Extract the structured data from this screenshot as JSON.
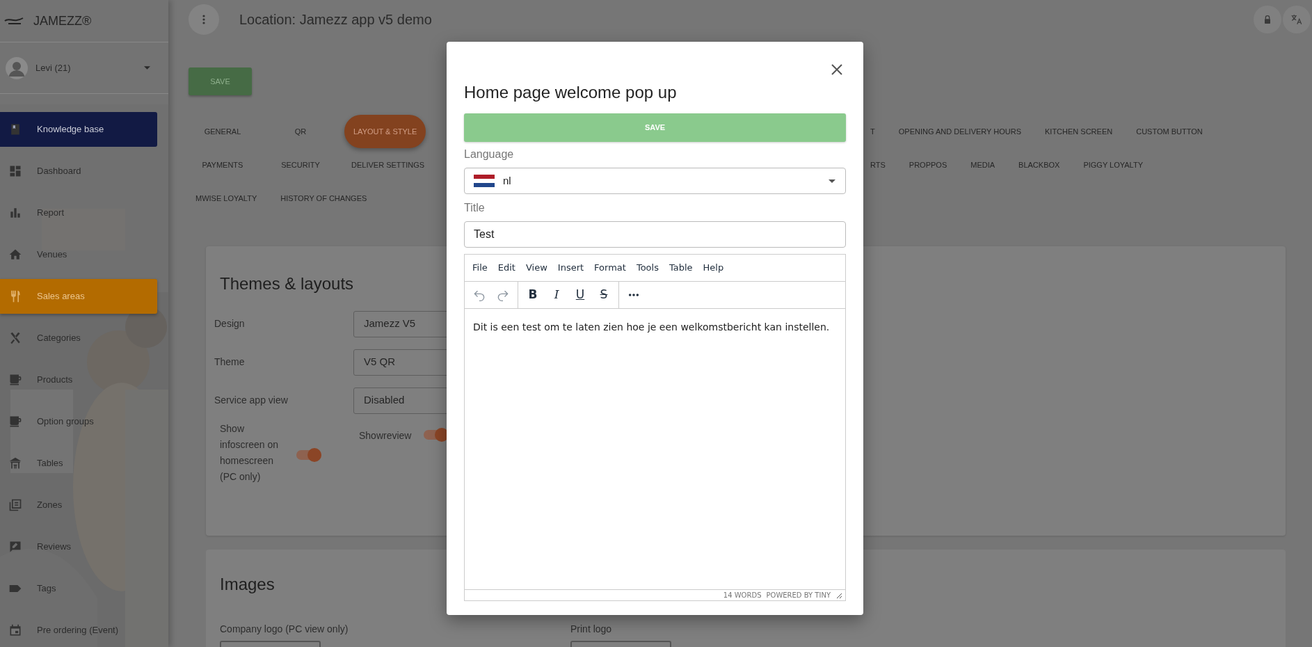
{
  "brand": {
    "name": "JAMEZZ®"
  },
  "user": {
    "name": "Levi (21)"
  },
  "sidebar": {
    "items": [
      {
        "label": "Knowledge base",
        "kind": "featured",
        "selected": false
      },
      {
        "label": "Dashboard",
        "kind": "link",
        "selected": false
      },
      {
        "label": "Report",
        "kind": "link",
        "selected": false
      },
      {
        "label": "Venues",
        "kind": "link",
        "selected": false
      },
      {
        "label": "Sales areas",
        "kind": "link",
        "selected": true
      },
      {
        "label": "Categories",
        "kind": "link",
        "selected": false
      },
      {
        "label": "Products",
        "kind": "link",
        "selected": false
      },
      {
        "label": "Option groups",
        "kind": "link",
        "selected": false
      },
      {
        "label": "Tables",
        "kind": "link",
        "selected": false
      },
      {
        "label": "Zones",
        "kind": "link",
        "selected": false
      },
      {
        "label": "Reviews",
        "kind": "link",
        "selected": false
      },
      {
        "label": "Tags",
        "kind": "link",
        "selected": false
      },
      {
        "label": "Pre ordering (Event)",
        "kind": "link",
        "selected": false
      }
    ]
  },
  "header": {
    "title": "Location: Jamezz app v5 demo"
  },
  "save_button": "SAVE",
  "tab_rows": [
    {
      "left": [
        {
          "label": "GENERAL",
          "selected": false
        },
        {
          "label": "QR",
          "selected": false
        },
        {
          "label": "LAYOUT & STYLE",
          "selected": true
        }
      ],
      "right": [
        {
          "label": "T",
          "selected": false
        },
        {
          "label": "OPENING AND DELIVERY HOURS",
          "selected": false
        },
        {
          "label": "KITCHEN SCREEN",
          "selected": false
        },
        {
          "label": "CUSTOM BUTTON",
          "selected": false
        }
      ]
    },
    {
      "left": [
        {
          "label": "PAYMENTS",
          "selected": false
        },
        {
          "label": "SECURITY",
          "selected": false
        },
        {
          "label": "DELIVER SETTINGS",
          "selected": false
        }
      ],
      "right": [
        {
          "label": "RTS",
          "selected": false
        },
        {
          "label": "PROPPOS",
          "selected": false
        },
        {
          "label": "MEDIA",
          "selected": false
        },
        {
          "label": "BLACKBOX",
          "selected": false
        },
        {
          "label": "PIGGY LOYALTY",
          "selected": false
        }
      ]
    },
    {
      "left": [
        {
          "label": "MWISE LOYALTY",
          "selected": false
        },
        {
          "label": "HISTORY OF CHANGES",
          "selected": false
        }
      ],
      "right": []
    }
  ],
  "themes_card": {
    "title": "Themes & layouts",
    "fields": [
      {
        "label": "Design",
        "value": "Jamezz V5"
      },
      {
        "label": "Theme",
        "value": "V5 QR"
      },
      {
        "label": "Service app view",
        "value": "Disabled"
      }
    ],
    "toggles": [
      {
        "label": "Show infoscreen on homescreen (PC only)",
        "on": true
      },
      {
        "label": "Showreview",
        "on": true
      }
    ]
  },
  "images_card": {
    "title": "Images",
    "labels": [
      "Company logo (PC view only)",
      "Print logo"
    ]
  },
  "modal": {
    "title": "Home page welcome pop up",
    "save_button": "SAVE",
    "language": {
      "label": "Language",
      "value": "nl"
    },
    "title_field": {
      "label": "Title",
      "value": "Test"
    },
    "editor": {
      "menu": [
        "File",
        "Edit",
        "View",
        "Insert",
        "Format",
        "Tools",
        "Table",
        "Help"
      ],
      "toolbar": [
        {
          "kind": "undo",
          "disabled": true
        },
        {
          "kind": "redo",
          "disabled": true
        },
        {
          "kind": "bold",
          "label": "B",
          "disabled": false
        },
        {
          "kind": "italic",
          "label": "I",
          "disabled": false
        },
        {
          "kind": "underline",
          "label": "U",
          "disabled": false
        },
        {
          "kind": "strike",
          "label": "S",
          "disabled": false
        },
        {
          "kind": "more",
          "disabled": false
        }
      ],
      "content": "Dit is een test om te laten zien hoe je een welkomstbericht kan instellen.",
      "word_count": "14 WORDS",
      "powered_by": "POWERED BY TINY"
    }
  }
}
